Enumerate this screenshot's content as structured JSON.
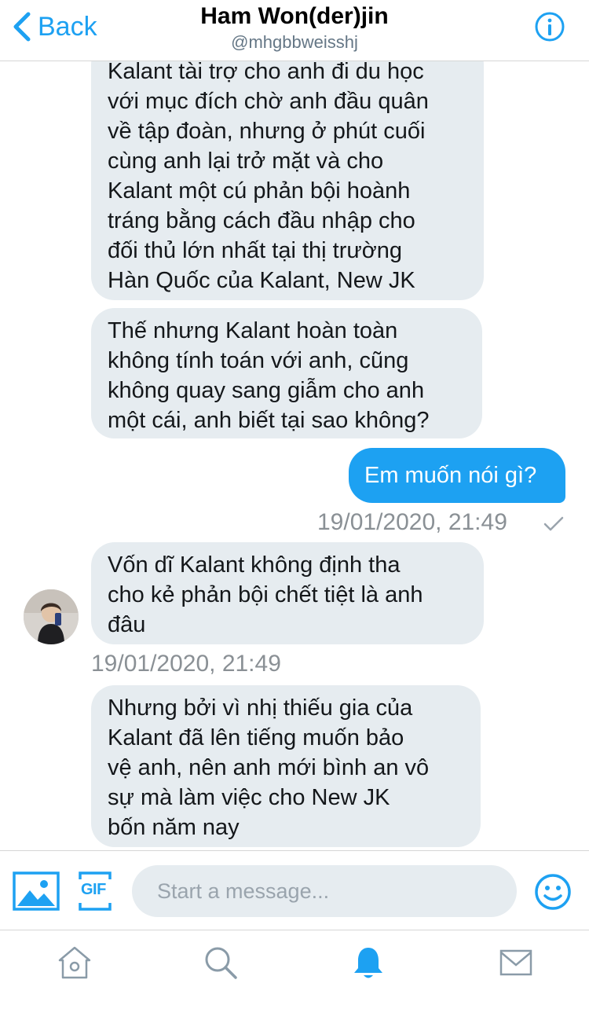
{
  "header": {
    "back_label": "Back",
    "title": "Ham Won(der)jin",
    "handle": "@mhgbbweisshj",
    "back_icon": "chevron-left-icon",
    "info_icon": "info-icon",
    "accent": "#1da1f2"
  },
  "messages": [
    {
      "direction": "in",
      "text": "Kalant tài trợ cho anh đi du học\nvới mục đích chờ anh đầu quân\nvề tập đoàn, nhưng ở phút cuối\ncùng anh lại trở mặt và cho\nKalant một cú phản bội hoành\ntráng bằng cách đầu nhập cho\nđối thủ lớn nhất tại thị trường\nHàn Quốc của Kalant, New JK"
    },
    {
      "direction": "in",
      "text": "Thế nhưng Kalant hoàn toàn\nkhông tính toán với anh, cũng\nkhông quay sang giẫm cho anh\nmột cái, anh biết tại sao không?"
    },
    {
      "direction": "out",
      "text": "Em muốn nói gì?",
      "timestamp": "19/01/2020, 21:49"
    },
    {
      "direction": "in",
      "text": "Vốn dĩ Kalant không định tha\ncho kẻ phản bội chết tiệt là anh\nđâu",
      "timestamp": "19/01/2020, 21:49"
    },
    {
      "direction": "in",
      "text": "Nhưng bởi vì nhị thiếu gia của\nKalant đã lên tiếng muốn bảo\nvệ anh, nên anh mới bình an vô\nsự mà làm việc cho New JK\nbốn năm nay"
    }
  ],
  "composer": {
    "placeholder": "Start a message...",
    "media_icon": "image-icon",
    "gif_icon": "gif-icon",
    "gif_label": "GIF",
    "emoji_icon": "emoji-icon"
  },
  "tabbar": {
    "items": [
      "home-icon",
      "search-icon",
      "notifications-bell-icon",
      "messages-icon"
    ],
    "active": "notifications-bell-icon"
  },
  "colors": {
    "incoming_bubble": "#e6ecf0",
    "outgoing_bubble": "#1da1f2",
    "timestamp": "#8a9095"
  }
}
